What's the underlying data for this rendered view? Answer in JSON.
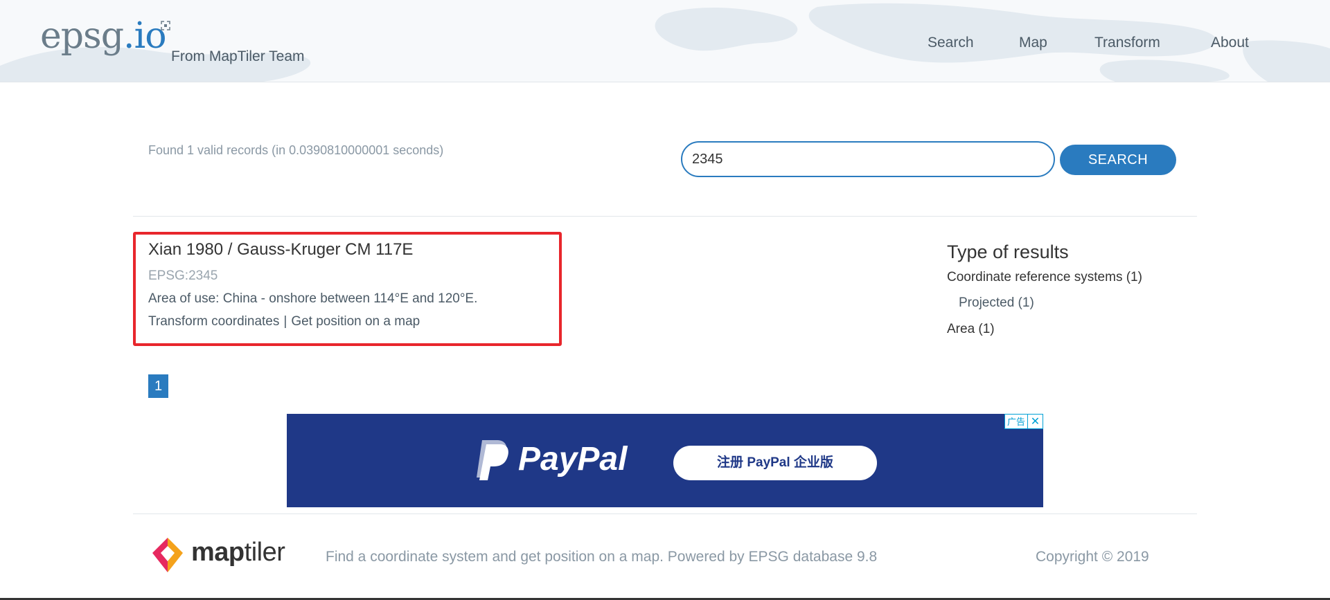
{
  "header": {
    "logo_main": "epsg",
    "logo_suffix": ".io",
    "tagline": "From MapTiler Team",
    "nav": [
      "Search",
      "Map",
      "Transform",
      "About"
    ]
  },
  "search": {
    "summary": "Found 1 valid records (in 0.0390810000001 seconds)",
    "value": "2345",
    "button_label": "SEARCH"
  },
  "result": {
    "title": "Xian 1980 / Gauss-Kruger CM 117E",
    "code": "EPSG:2345",
    "area": "Area of use: China - onshore between 114°E and 120°E.",
    "link_transform": "Transform coordinates",
    "separator": "|",
    "link_map": "Get position on a map"
  },
  "facets": {
    "title": "Type of results",
    "items": [
      "Coordinate reference systems (1)",
      "Projected (1)",
      "Area (1)"
    ]
  },
  "pagination": {
    "current": "1"
  },
  "ad": {
    "label": "广告",
    "close": "✕",
    "brand": "PayPal",
    "cta": "注册 PayPal 企业版"
  },
  "footer": {
    "brand_bold": "map",
    "brand_light": "tiler",
    "text": "Find a coordinate system and get position on a map. Powered by EPSG database 9.8",
    "copyright": "Copyright © 2019"
  },
  "colors": {
    "accent": "#2a7bbf",
    "highlight_border": "#e8262c",
    "ad_background": "#1f3887"
  }
}
